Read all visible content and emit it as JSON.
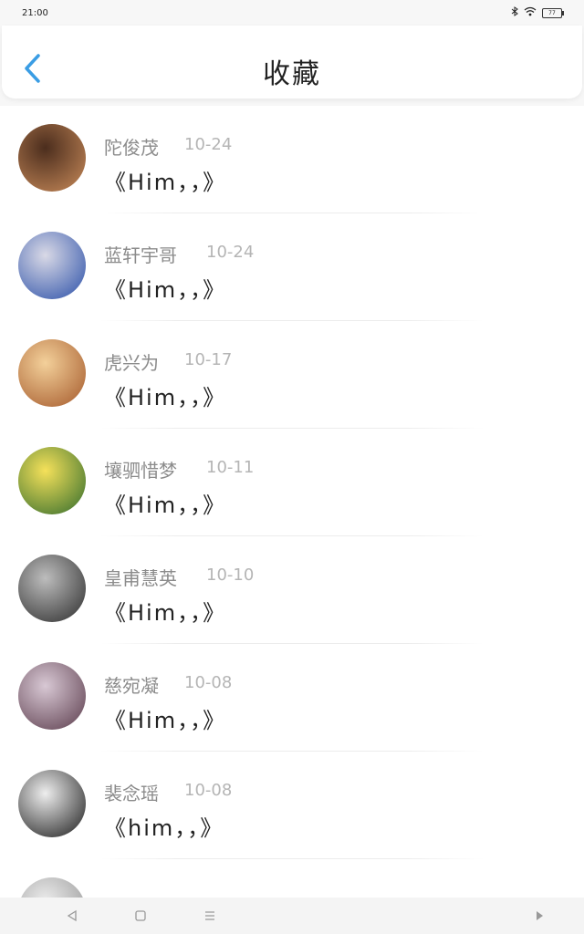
{
  "status": {
    "time": "21:00",
    "battery": "77"
  },
  "header": {
    "title": "收藏"
  },
  "items": [
    {
      "name": "陀俊茂",
      "date": "10-24",
      "book": "《Him，，》",
      "avatar_colors": [
        "#4b2d1d",
        "#c98b5a"
      ]
    },
    {
      "name": "蓝轩宇哥",
      "date": "10-24",
      "book": "《Him，，》",
      "avatar_colors": [
        "#d9d9e6",
        "#2a4fa8"
      ]
    },
    {
      "name": "虎兴为",
      "date": "10-17",
      "book": "《Him，，》",
      "avatar_colors": [
        "#f3d09a",
        "#a4582a"
      ]
    },
    {
      "name": "壤驷惜梦",
      "date": "10-11",
      "book": "《Him，，》",
      "avatar_colors": [
        "#f5e15a",
        "#2f6a2c"
      ]
    },
    {
      "name": "皇甫慧英",
      "date": "10-10",
      "book": "《Him，，》",
      "avatar_colors": [
        "#bdbdbd",
        "#2b2b2b"
      ]
    },
    {
      "name": "慈宛凝",
      "date": "10-08",
      "book": "《Him，，》",
      "avatar_colors": [
        "#d8c8d4",
        "#5a3b4b"
      ]
    },
    {
      "name": "裴念瑶",
      "date": "10-08",
      "book": "《him，，》",
      "avatar_colors": [
        "#eeeeee",
        "#1a1a1a"
      ]
    },
    {
      "name": "",
      "date": "",
      "book": "",
      "avatar_colors": [
        "#ececec",
        "#8f8f8f"
      ]
    }
  ]
}
